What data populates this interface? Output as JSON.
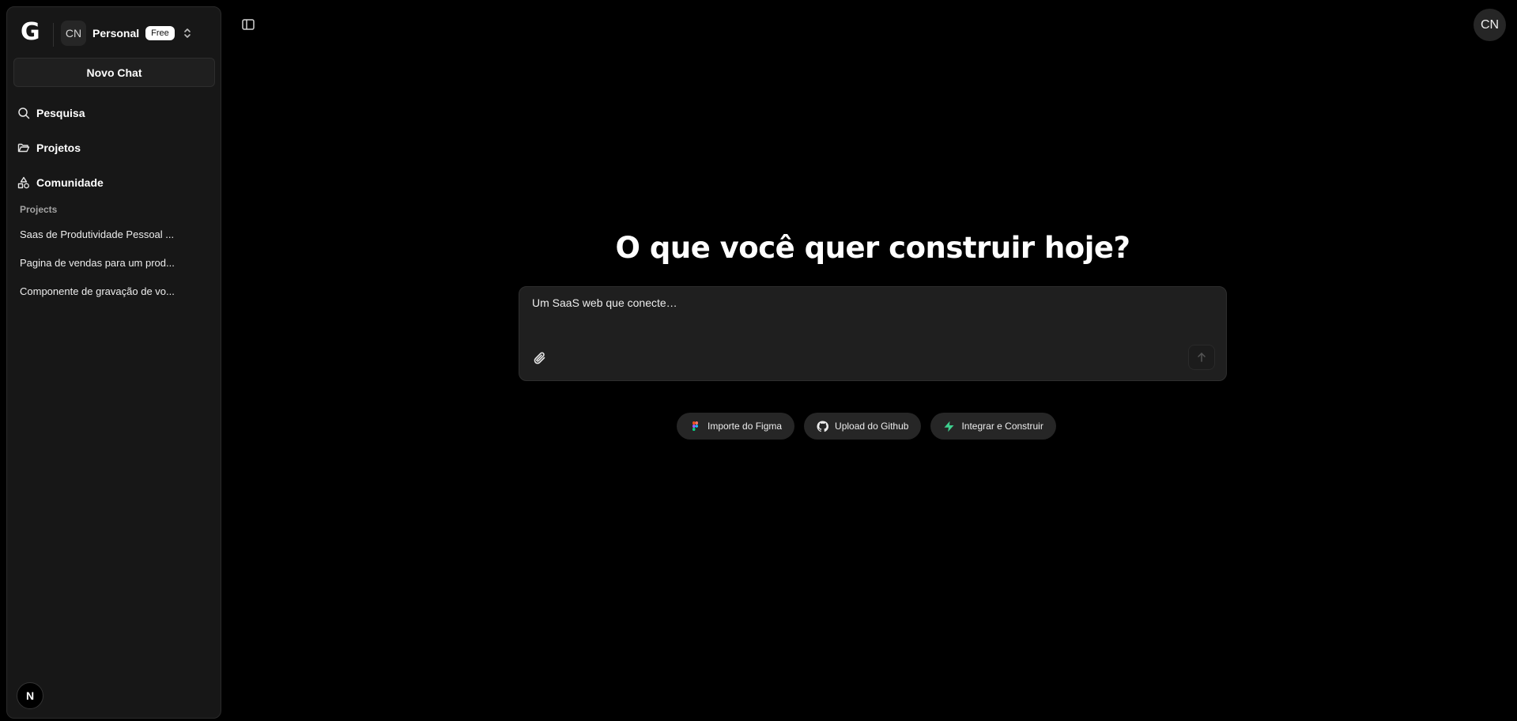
{
  "sidebar": {
    "logo": "G",
    "team": {
      "initials": "CN",
      "name": "Personal",
      "plan": "Free"
    },
    "new_chat": "Novo Chat",
    "nav": [
      {
        "label": "Pesquisa",
        "icon": "search-icon"
      },
      {
        "label": "Projetos",
        "icon": "folder-icon"
      },
      {
        "label": "Comunidade",
        "icon": "shapes-icon"
      }
    ],
    "projects_label": "Projects",
    "projects": [
      "Saas de Produtividade Pessoal ...",
      "Pagina de vendas para um prod...",
      "Componente de gravação de vo..."
    ],
    "footer_badge": "N"
  },
  "user": {
    "initials": "CN"
  },
  "main": {
    "title": "O que você quer construir hoje?",
    "prompt_placeholder": "Um SaaS web que conecte…",
    "chips": [
      {
        "label": "Importe do Figma",
        "icon": "figma-icon"
      },
      {
        "label": "Upload do Github",
        "icon": "github-icon"
      },
      {
        "label": "Integrar e Construir",
        "icon": "supabase-icon"
      }
    ]
  },
  "colors": {
    "background": "#000000",
    "sidebar": "#171717",
    "accent_green": "#3ecf8e"
  }
}
